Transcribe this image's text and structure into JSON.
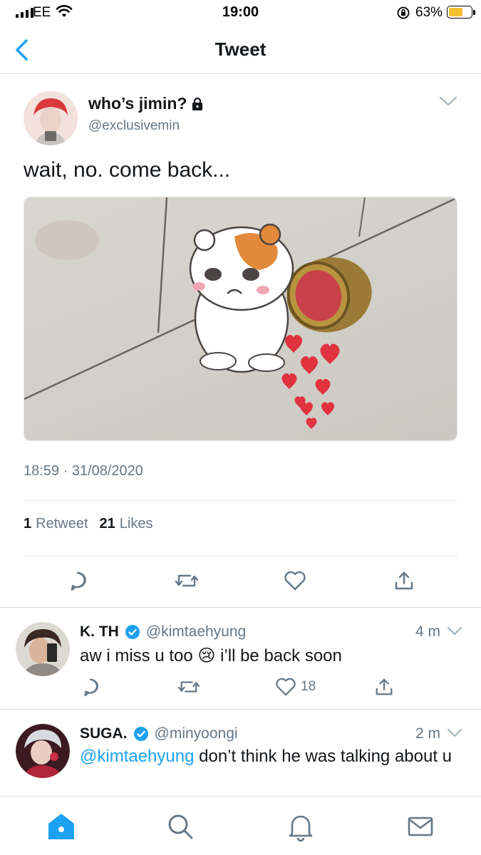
{
  "status_bar": {
    "carrier": "EE",
    "time": "19:00",
    "battery_percent": "63%",
    "battery_level": 0.63
  },
  "nav": {
    "title": "Tweet"
  },
  "main_tweet": {
    "author_name": "who’s jimin?",
    "author_handle": "@exclusivemin",
    "text": "wait, no. come back...",
    "timestamp": "18:59 · 31/08/2020",
    "retweet_count": "1",
    "retweet_label": "Retweet",
    "like_count": "21",
    "like_label": "Likes"
  },
  "replies": [
    {
      "name": "K. TH",
      "handle": "@kimtaehyung",
      "time": "4 m",
      "text_before": "aw i miss u too ",
      "emoji": "😢",
      "text_after": " i’ll be back soon",
      "like_count": "18"
    },
    {
      "name": "SUGA.",
      "handle": "@minyoongi",
      "time": "2 m",
      "mention": "@kimtaehyung",
      "text": " don’t think he was talking about u"
    }
  ],
  "colors": {
    "accent": "#1da1f2",
    "secondary_text": "#657786",
    "verified": "#1da1f2"
  },
  "icons": [
    "wifi-icon",
    "lock-icon",
    "back-chevron-icon",
    "reply-icon",
    "retweet-icon",
    "like-icon",
    "share-icon",
    "verified-icon",
    "home-icon",
    "search-icon",
    "notifications-icon",
    "messages-icon"
  ]
}
